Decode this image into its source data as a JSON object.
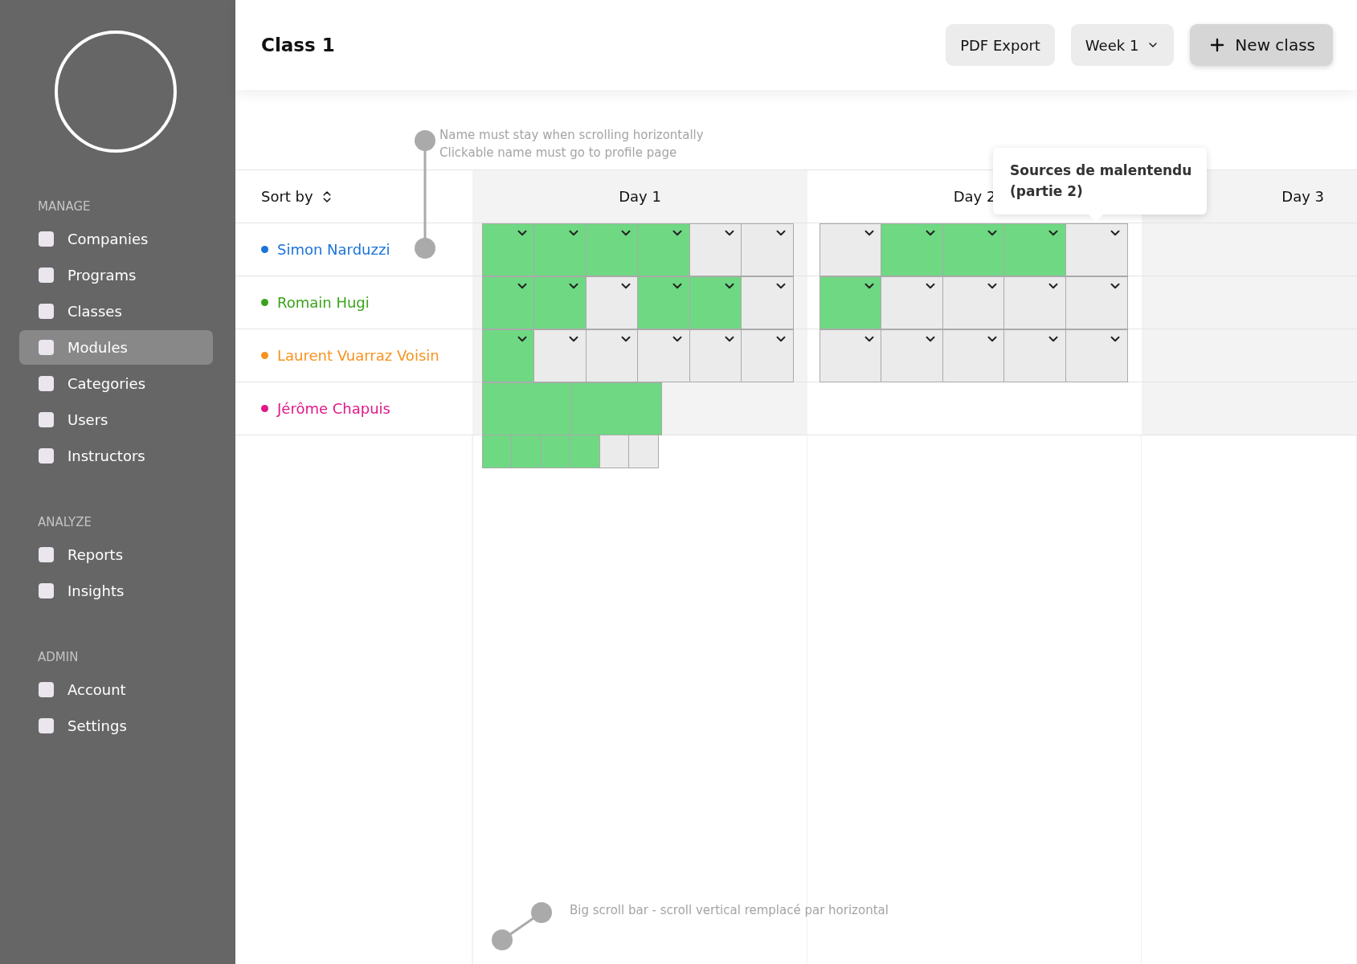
{
  "sidebar": {
    "sections": [
      {
        "heading": "MANAGE",
        "items": [
          {
            "label": "Companies",
            "selected": false
          },
          {
            "label": "Programs",
            "selected": false
          },
          {
            "label": "Classes",
            "selected": false
          },
          {
            "label": "Modules",
            "selected": true
          },
          {
            "label": "Categories",
            "selected": false
          },
          {
            "label": "Users",
            "selected": false
          },
          {
            "label": "Instructors",
            "selected": false
          }
        ]
      },
      {
        "heading": "ANALYZE",
        "items": [
          {
            "label": "Reports",
            "selected": false
          },
          {
            "label": "Insights",
            "selected": false
          }
        ]
      },
      {
        "heading": "ADMIN",
        "items": [
          {
            "label": "Account",
            "selected": false
          },
          {
            "label": "Settings",
            "selected": false
          }
        ]
      }
    ]
  },
  "header": {
    "title": "Class 1",
    "buttons": [
      {
        "kind": "plain",
        "label": "PDF Export"
      },
      {
        "kind": "dropdown",
        "label": "Week 1"
      },
      {
        "kind": "primary",
        "label": "New class"
      }
    ]
  },
  "annotations": [
    {
      "kind": "vertical",
      "lines": [
        "Name must stay when scrolling horizontally",
        "Clickable name must go to profile page"
      ]
    },
    {
      "kind": "diagonal",
      "lines": [
        "Big scroll bar - scroll vertical remplacé par horizontal"
      ]
    }
  ],
  "table": {
    "sort_label": "Sort by",
    "days": [
      {
        "label": "Day 1",
        "shaded": true
      },
      {
        "label": "Day 2",
        "shaded": false
      },
      {
        "label": "Day 3",
        "shaded": true
      }
    ],
    "tooltip": {
      "lines": [
        "Sources de malentendu",
        "(partie 2)"
      ]
    },
    "rows": [
      {
        "name": "Simon Narduzzi",
        "color": "#1a73d9",
        "days": [
          {
            "kind": "slots",
            "cells": [
              {
                "done": true
              },
              {
                "done": true
              },
              {
                "done": true
              },
              {
                "done": true
              },
              {
                "done": false
              },
              {
                "done": false
              }
            ]
          },
          {
            "kind": "slots",
            "cells": [
              {
                "done": false
              },
              {
                "done": true
              },
              {
                "done": true
              },
              {
                "done": true
              },
              {
                "done": false
              }
            ]
          }
        ]
      },
      {
        "name": "Romain Hugi",
        "color": "#3aa31b",
        "days": [
          {
            "kind": "slots",
            "cells": [
              {
                "done": true
              },
              {
                "done": true
              },
              {
                "done": false
              },
              {
                "done": true
              },
              {
                "done": true
              },
              {
                "done": false
              }
            ]
          },
          {
            "kind": "slots",
            "cells": [
              {
                "done": true
              },
              {
                "done": false
              },
              {
                "done": false
              },
              {
                "done": false
              },
              {
                "done": false
              }
            ]
          }
        ]
      },
      {
        "name": "Laurent Vuarraz Voisin",
        "color": "#f7921e",
        "days": [
          {
            "kind": "slots",
            "cells": [
              {
                "done": true
              },
              {
                "done": false
              },
              {
                "done": false
              },
              {
                "done": false
              },
              {
                "done": false
              },
              {
                "done": false
              }
            ]
          },
          {
            "kind": "slots",
            "cells": [
              {
                "done": false
              },
              {
                "done": false
              },
              {
                "done": false
              },
              {
                "done": false
              },
              {
                "done": false
              }
            ]
          }
        ]
      },
      {
        "name": "Jérôme Chapuis",
        "color": "#e0198a",
        "days": [
          {
            "kind": "split",
            "top": [
              {
                "done": true
              },
              {
                "done": true
              }
            ],
            "bottom": [
              {
                "done": true
              },
              {
                "done": true
              },
              {
                "done": true
              },
              {
                "done": true
              },
              {
                "done": false
              },
              {
                "done": false
              }
            ]
          }
        ]
      }
    ]
  }
}
